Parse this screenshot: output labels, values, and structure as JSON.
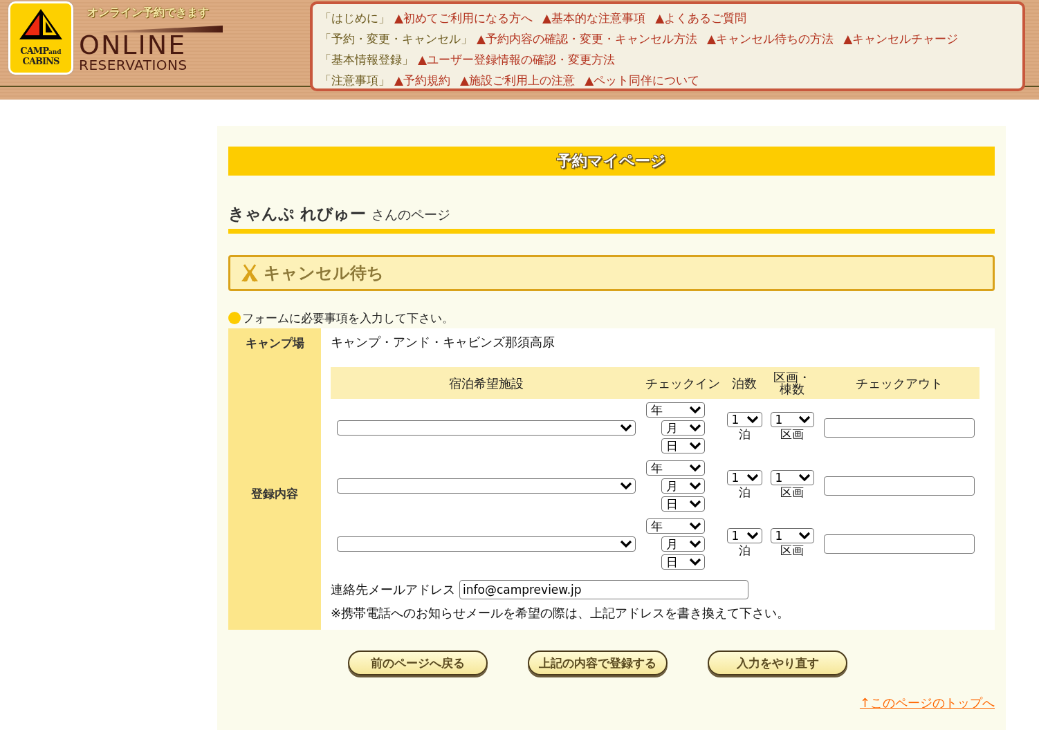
{
  "header": {
    "logo": {
      "line1": "CAMP",
      "small": "and",
      "line2": "CABINS"
    },
    "tagline": "オンライン予約できます",
    "title": "ONLINE",
    "subtitle": "RESERVATIONS"
  },
  "nav": [
    [
      {
        "kind": "section",
        "text": "「はじめに」"
      },
      {
        "kind": "link",
        "text": "▲初めてご利用になる方へ"
      },
      {
        "kind": "link",
        "text": "▲基本的な注意事項"
      },
      {
        "kind": "link",
        "text": "▲よくあるご質問"
      }
    ],
    [
      {
        "kind": "section",
        "text": "「予約・変更・キャンセル」"
      },
      {
        "kind": "link",
        "text": "▲予約内容の確認・変更・キャンセル方法"
      },
      {
        "kind": "link",
        "text": "▲キャンセル待ちの方法"
      },
      {
        "kind": "link",
        "text": "▲キャンセルチャージ"
      }
    ],
    [
      {
        "kind": "section",
        "text": "「基本情報登録」"
      },
      {
        "kind": "link",
        "text": "▲ユーザー登録情報の確認・変更方法"
      }
    ],
    [
      {
        "kind": "section",
        "text": "「注意事項」"
      },
      {
        "kind": "link",
        "text": "▲予約規約"
      },
      {
        "kind": "link",
        "text": "▲施設ご利用上の注意"
      },
      {
        "kind": "link",
        "text": "▲ペット同伴について"
      }
    ]
  ],
  "banner": "予約マイページ",
  "user": {
    "name": "きゃんぷ れびゅー",
    "suffix": "さんのページ"
  },
  "section_title": "キャンセル待ち",
  "instruction": "フォームに必要事項を入力して下さい。",
  "form": {
    "campsite": {
      "label": "キャンプ場",
      "value": "キャンプ・アンド・キャビンズ那須高原"
    },
    "registration": {
      "label": "登録内容",
      "columns": [
        "宿泊希望施設",
        "チェックイン",
        "泊数",
        "区画・棟数",
        "チェックアウト"
      ],
      "rows": [
        {
          "year": "年",
          "month": "月",
          "day": "日",
          "nights": "1",
          "nights_unit": "泊",
          "units": "1",
          "units_unit": "区画"
        },
        {
          "year": "年",
          "month": "月",
          "day": "日",
          "nights": "1",
          "nights_unit": "泊",
          "units": "1",
          "units_unit": "区画"
        },
        {
          "year": "年",
          "month": "月",
          "day": "日",
          "nights": "1",
          "nights_unit": "泊",
          "units": "1",
          "units_unit": "区画"
        }
      ],
      "email": {
        "label": "連絡先メールアドレス",
        "value": "info@campreview.jp"
      },
      "note": "※携帯電話へのお知らせメールを希望の際は、上記アドレスを書き換えて下さい。"
    }
  },
  "buttons": [
    "前のページへ戻る",
    "上記の内容で登録する",
    "入力をやり直す"
  ],
  "top_link": "↑このページのトップへ"
}
